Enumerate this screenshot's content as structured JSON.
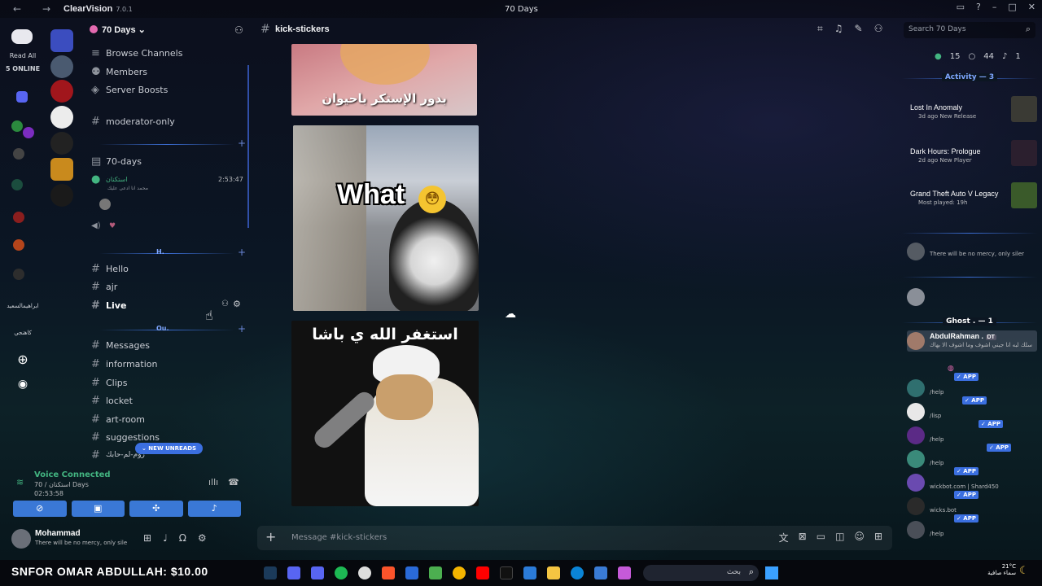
{
  "titlebar": {
    "app_name": "ClearVision",
    "version": "7.0.1",
    "window_title": "70 Days",
    "back": "←",
    "forward": "→"
  },
  "rail": {
    "read_all": "Read All",
    "online": "5 ONLINE",
    "text1": "ابراهيمالسعيد",
    "text2": "كاهنجي"
  },
  "server": {
    "name": "70 Days",
    "chevron": "⌄"
  },
  "channels": {
    "browse": "Browse Channels",
    "members": "Members",
    "boosts": "Server Boosts",
    "moderator": "moderator-only",
    "voice_channel": "70-days",
    "voice_user": "استكنان",
    "voice_user_status": "محمد انا ادعى عليك",
    "voice_time": "2:53:47",
    "cat_h": "H.",
    "hello": "Hello",
    "ajr": "ajr",
    "live": "Live",
    "cat_ou": "Ou.",
    "messages": "Messages",
    "information": "information",
    "clips": "Clips",
    "locket": "locket",
    "art_room": "art-room",
    "suggestions": "suggestions",
    "last": "روم-لم-حابك",
    "new_unreads": "⌄ NEW UNREADS"
  },
  "voice": {
    "connected": "Voice Connected",
    "sub": "70 / استكنان Days",
    "time": "02:53:58"
  },
  "user": {
    "name": "Mohammad",
    "status": "There will be no mercy, only sile"
  },
  "chat": {
    "channel": "kick-stickers",
    "search_placeholder": "Search 70 Days",
    "sticker1_caption": "بدور الإستكر باحيوان",
    "sticker2_caption": "What",
    "sticker2_emoji": "😳",
    "sticker3_caption": "استغفر الله ي باشا",
    "message_placeholder": "Message #kick-stickers"
  },
  "right": {
    "stat_online": "15",
    "stat_members": "44",
    "stat_voice": "1",
    "activity_label": "Activity — 3",
    "act1_title": "Lost In Anomaly",
    "act1_sub": "3d ago  New Release",
    "act2_title": "Dark Hours: Prologue",
    "act2_sub": "2d ago  New Player",
    "act3_title": "Grand Theft Auto V Legacy",
    "act3_sub": "Most played: 19h",
    "member1_status": "There will be no mercy, only siler",
    "ghost_label": "Ghost . — 1",
    "ghost_member": "AbdulRahman .",
    "ghost_tag": "DT",
    "ghost_sub": "سلك لبه انا جيني اشوف وما اشوف الا بهاك",
    "bots": [
      {
        "sub": "/help"
      },
      {
        "sub": "/lisp"
      },
      {
        "sub": "/help"
      },
      {
        "sub": "/help"
      },
      {
        "sub": "wickbot.com | Shard450"
      },
      {
        "sub": "wicks.bot"
      },
      {
        "sub": "/help"
      }
    ],
    "app_badge": "✓ APP"
  },
  "taskbar": {
    "tip": "SNFOR OMAR ABDULLAH: $10.00",
    "search": "بحث",
    "temp": "21°C",
    "weather": "سماء صافية"
  },
  "colors": {
    "accent": "#3b6fe0",
    "online": "#43b581"
  }
}
